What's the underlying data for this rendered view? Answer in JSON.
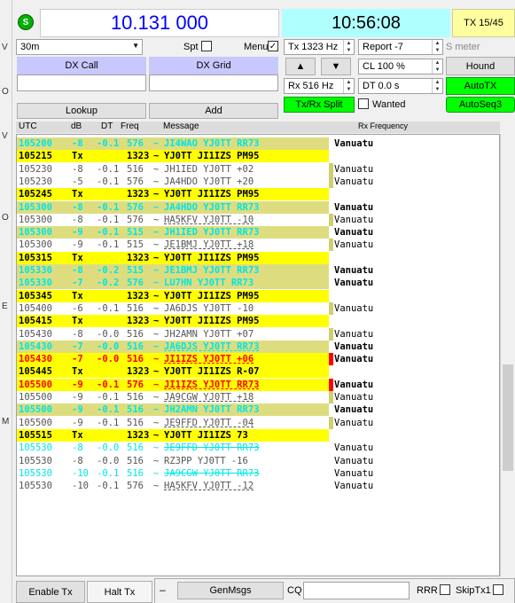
{
  "left_strip": [
    "V",
    "O",
    "V",
    "O",
    "E",
    "M"
  ],
  "status_icon": "S",
  "frequency": "10.131 000",
  "clock": "10:56:08",
  "tx_period": "TX 15/45",
  "band": "30m",
  "spt_label": "Spt",
  "menu_label": "Menu",
  "tx_freq": "Tx  1323  Hz",
  "rx_freq": "Rx  516  Hz",
  "report": "Report -7",
  "s_meter": "S meter",
  "cl": "CL  100 %",
  "dt": "DT 0.0 s",
  "dx_call_label": "DX Call",
  "dx_grid_label": "DX Grid",
  "lookup_label": "Lookup",
  "add_label": "Add",
  "txrx_split_label": "Tx/Rx Split",
  "wanted_label": "Wanted",
  "hound_label": "Hound",
  "autotx_label": "AutoTX",
  "autoseq_label": "AutoSeq3",
  "up_arrow": "▲",
  "down_arrow": "▼",
  "header": {
    "utc": "UTC",
    "db": "dB",
    "dt": "DT",
    "freq": "Freq",
    "message": "Message",
    "rx_frequency": "Rx Frequency"
  },
  "rows": [
    {
      "utc": "105200",
      "db": "-8",
      "dt": "-0.1",
      "freq": "576",
      "sep": "~",
      "msg": "JI4WAO YJ0TT RR73",
      "country": "Vanuatu",
      "style": "cyan_bold"
    },
    {
      "utc": "105215",
      "db": "Tx",
      "dt": "",
      "freq": "1323",
      "sep": "~",
      "msg": "YJ0TT JI1IZS PM95",
      "country": "",
      "style": "tx"
    },
    {
      "utc": "105230",
      "db": "-8",
      "dt": "-0.1",
      "freq": "516",
      "sep": "~",
      "msg": "JH1IED YJ0TT +02",
      "country": "Vanuatu",
      "style": "normal_mark"
    },
    {
      "utc": "105230",
      "db": "-5",
      "dt": "-0.1",
      "freq": "576",
      "sep": "~",
      "msg": "JA4HDO YJ0TT +20",
      "country": "Vanuatu",
      "style": "normal_mark"
    },
    {
      "utc": "105245",
      "db": "Tx",
      "dt": "",
      "freq": "1323",
      "sep": "~",
      "msg": "YJ0TT JI1IZS PM95",
      "country": "",
      "style": "tx"
    },
    {
      "utc": "105300",
      "db": "-8",
      "dt": "-0.1",
      "freq": "576",
      "sep": "~",
      "msg": "JA4HDO YJ0TT RR73",
      "country": "Vanuatu",
      "style": "cyan_bold"
    },
    {
      "utc": "105300",
      "db": "-8",
      "dt": "-0.1",
      "freq": "576",
      "sep": "~",
      "msg": "HA5KFV YJ0TT -10",
      "country": "Vanuatu",
      "style": "normal_mark_ul"
    },
    {
      "utc": "105300",
      "db": "-9",
      "dt": "-0.1",
      "freq": "515",
      "sep": "~",
      "msg": "JH1IED YJ0TT RR73",
      "country": "Vanuatu",
      "style": "cyan_bold"
    },
    {
      "utc": "105300",
      "db": "-9",
      "dt": "-0.1",
      "freq": "515",
      "sep": "~",
      "msg": "JE1BMJ YJ0TT +18",
      "country": "Vanuatu",
      "style": "normal_mark_ul"
    },
    {
      "utc": "105315",
      "db": "Tx",
      "dt": "",
      "freq": "1323",
      "sep": "~",
      "msg": "YJ0TT JI1IZS PM95",
      "country": "",
      "style": "tx"
    },
    {
      "utc": "105330",
      "db": "-8",
      "dt": "-0.2",
      "freq": "515",
      "sep": "~",
      "msg": "JE1BMJ YJ0TT RR73",
      "country": "Vanuatu",
      "style": "cyan_bold"
    },
    {
      "utc": "105330",
      "db": "-7",
      "dt": "-0.2",
      "freq": "576",
      "sep": "~",
      "msg": "LU7HN YJ0TT RR73",
      "country": "Vanuatu",
      "style": "cyan_bold"
    },
    {
      "utc": "105345",
      "db": "Tx",
      "dt": "",
      "freq": "1323",
      "sep": "~",
      "msg": "YJ0TT JI1IZS PM95",
      "country": "",
      "style": "tx"
    },
    {
      "utc": "105400",
      "db": "-6",
      "dt": "-0.1",
      "freq": "516",
      "sep": "~",
      "msg": "JA6DJS YJ0TT -10",
      "country": "Vanuatu",
      "style": "normal_mark"
    },
    {
      "utc": "105415",
      "db": "Tx",
      "dt": "",
      "freq": "1323",
      "sep": "~",
      "msg": "YJ0TT JI1IZS PM95",
      "country": "",
      "style": "tx"
    },
    {
      "utc": "105430",
      "db": "-8",
      "dt": "-0.0",
      "freq": "516",
      "sep": "~",
      "msg": "JH2AMN YJ0TT +07",
      "country": "Vanuatu",
      "style": "normal_mark"
    },
    {
      "utc": "105430",
      "db": "-7",
      "dt": "-0.0",
      "freq": "516",
      "sep": "~",
      "msg": "JA6DJS YJ0TT RR73",
      "country": "Vanuatu",
      "style": "cyan_bold_ul"
    },
    {
      "utc": "105430",
      "db": "-7",
      "dt": "-0.0",
      "freq": "516",
      "sep": "~",
      "msg": "JI1IZS YJ0TT +06",
      "country": "Vanuatu",
      "style": "red"
    },
    {
      "utc": "105445",
      "db": "Tx",
      "dt": "",
      "freq": "1323",
      "sep": "~",
      "msg": "YJ0TT JI1IZS R-07",
      "country": "",
      "style": "tx"
    },
    {
      "utc": "105500",
      "db": "-9",
      "dt": "-0.1",
      "freq": "576",
      "sep": "~",
      "msg": "JI1IZS YJ0TT RR73",
      "country": "Vanuatu",
      "style": "red"
    },
    {
      "utc": "105500",
      "db": "-9",
      "dt": "-0.1",
      "freq": "516",
      "sep": "~",
      "msg": "JA9CGW YJ0TT +18",
      "country": "Vanuatu",
      "style": "normal_mark_ul"
    },
    {
      "utc": "105500",
      "db": "-9",
      "dt": "-0.1",
      "freq": "516",
      "sep": "~",
      "msg": "JH2AMN YJ0TT RR73",
      "country": "Vanuatu",
      "style": "cyan_bold"
    },
    {
      "utc": "105500",
      "db": "-9",
      "dt": "-0.1",
      "freq": "516",
      "sep": "~",
      "msg": "JE9FFD YJ0TT -04",
      "country": "Vanuatu",
      "style": "normal_mark_ul"
    },
    {
      "utc": "105515",
      "db": "Tx",
      "dt": "",
      "freq": "1323",
      "sep": "~",
      "msg": "YJ0TT JI1IZS 73",
      "country": "",
      "style": "tx"
    },
    {
      "utc": "105530",
      "db": "-8",
      "dt": "-0.0",
      "freq": "516",
      "sep": "~",
      "msg": "JE9FFD YJ0TT RR73",
      "country": "Vanuatu",
      "style": "cyan_strike"
    },
    {
      "utc": "105530",
      "db": "-8",
      "dt": "-0.0",
      "freq": "516",
      "sep": "~",
      "msg": "RZ3PP YJ0TT -16",
      "country": "Vanuatu",
      "style": "plain"
    },
    {
      "utc": "105530",
      "db": "-10",
      "dt": "-0.1",
      "freq": "516",
      "sep": "~",
      "msg": "JA9CGW YJ0TT RR73",
      "country": "Vanuatu",
      "style": "cyan_strike"
    },
    {
      "utc": "105530",
      "db": "-10",
      "dt": "-0.1",
      "freq": "576",
      "sep": "~",
      "msg": "HA5KFV YJ0TT -12",
      "country": "Vanuatu",
      "style": "plain_ul"
    }
  ],
  "bottom": {
    "enable_tx": "Enable Tx",
    "halt_tx": "Halt Tx",
    "dash": "–",
    "genmsgs": "GenMsgs",
    "cq": "CQ",
    "rrr": "RRR",
    "skiptx1": "SkipTx1"
  },
  "colors": {
    "tx_yellow": "#ffff00",
    "cyan_text": "#00e5e5",
    "cyan_bg": "#dddd80",
    "red_text": "#ff0000",
    "mark_olive": "#cfcf70",
    "mark_red": "#ff0000",
    "autotx_green": "#00ff00",
    "freq_blue": "#0000ff"
  }
}
